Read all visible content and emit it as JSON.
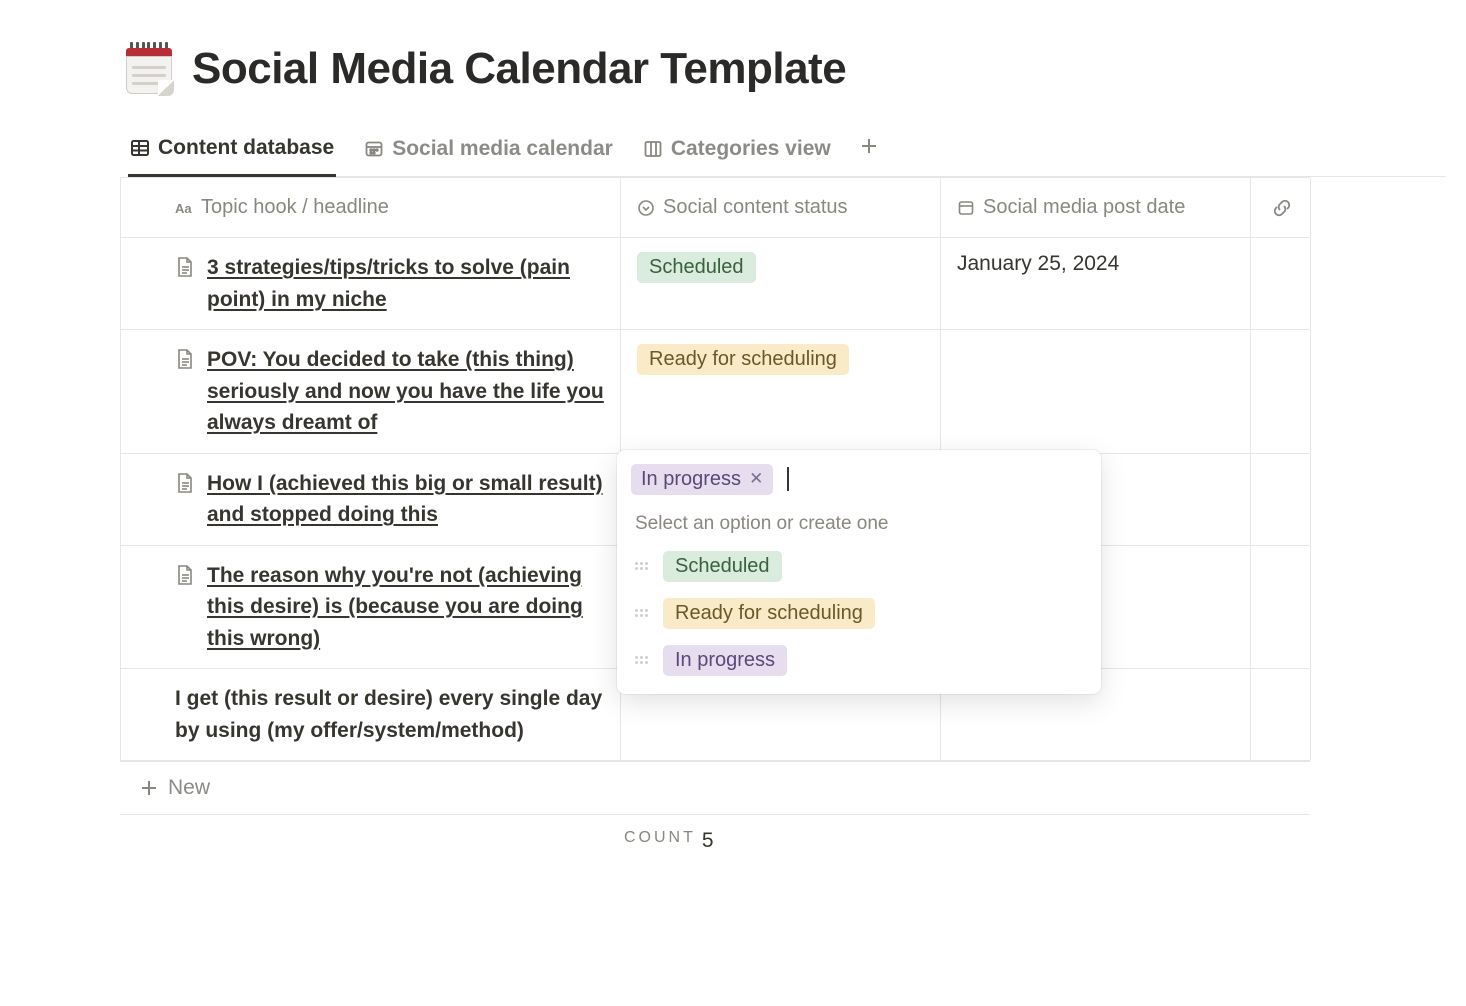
{
  "page": {
    "title": "Social Media Calendar Template",
    "icon": "calendar-notepad-icon"
  },
  "tabs": [
    {
      "id": "content-db",
      "label": "Content database",
      "icon": "table-icon",
      "active": true
    },
    {
      "id": "calendar",
      "label": "Social media calendar",
      "icon": "calendar-month-icon",
      "active": false
    },
    {
      "id": "categories",
      "label": "Categories view",
      "icon": "board-columns-icon",
      "active": false
    }
  ],
  "columns": {
    "topic": {
      "label": "Topic hook / headline",
      "icon": "text-aa-icon"
    },
    "status": {
      "label": "Social content status",
      "icon": "select-circle-icon"
    },
    "date": {
      "label": "Social media post date",
      "icon": "calendar-small-icon"
    },
    "link": {
      "icon": "chain-link-icon"
    }
  },
  "rows": [
    {
      "topic": "3 strategies/tips/tricks to solve (pain point) in my niche",
      "has_doc_icon": true,
      "status": "Scheduled",
      "status_class": "Scheduled",
      "date": "January 25, 2024"
    },
    {
      "topic": "POV: You decided to take (this thing) seriously and now you have the life you always dreamt of",
      "has_doc_icon": true,
      "status": "Ready for scheduling",
      "status_class": "ReadyForScheduling",
      "date": ""
    },
    {
      "topic": "How I (achieved this big or small result) and stopped doing this",
      "has_doc_icon": true,
      "status": "",
      "status_class": "",
      "date": "",
      "open_editor": true
    },
    {
      "topic": "The reason why you're not (achieving this desire) is (because you are doing this wrong)",
      "has_doc_icon": true,
      "status": "",
      "status_class": "",
      "date": ""
    },
    {
      "topic": "I get (this result or desire) every single day by using (my offer/system/method)",
      "has_doc_icon": false,
      "status": "",
      "status_class": "",
      "date": ""
    }
  ],
  "status_editor": {
    "current": {
      "label": "In progress",
      "class": "InProgress"
    },
    "placeholder": "Select an option or create one",
    "options": [
      {
        "label": "Scheduled",
        "class": "Scheduled"
      },
      {
        "label": "Ready for scheduling",
        "class": "ReadyForScheduling"
      },
      {
        "label": "In progress",
        "class": "InProgress"
      }
    ]
  },
  "footer": {
    "new_label": "New",
    "count_label": "COUNT",
    "count_value": "5"
  }
}
